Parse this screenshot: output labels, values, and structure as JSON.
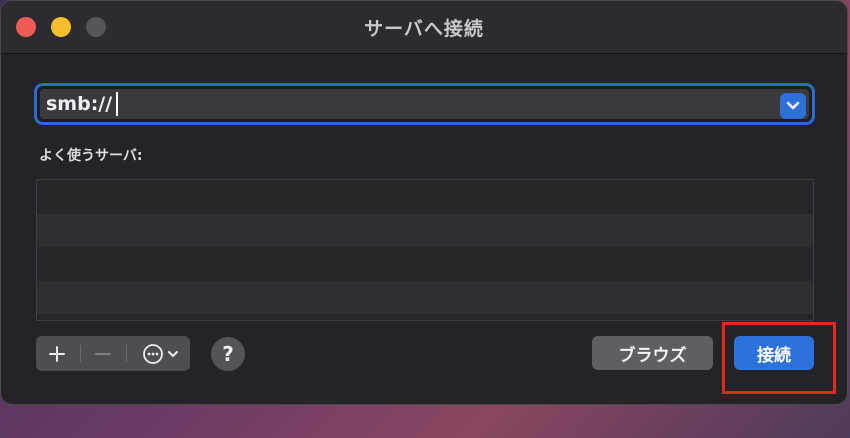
{
  "window": {
    "title": "サーバへ接続"
  },
  "address": {
    "value": "smb://"
  },
  "favorites": {
    "label": "よく使うサーバ:",
    "rows": [
      "",
      "",
      "",
      ""
    ]
  },
  "toolbar": {
    "add_icon": "plus-icon",
    "remove_icon": "minus-icon",
    "more_icon": "ellipsis-circle-icon"
  },
  "help": {
    "label": "?"
  },
  "buttons": {
    "browse_label": "ブラウズ",
    "connect_label": "接続"
  },
  "colors": {
    "accent": "#2d72db",
    "highlight": "#e22a1c"
  }
}
